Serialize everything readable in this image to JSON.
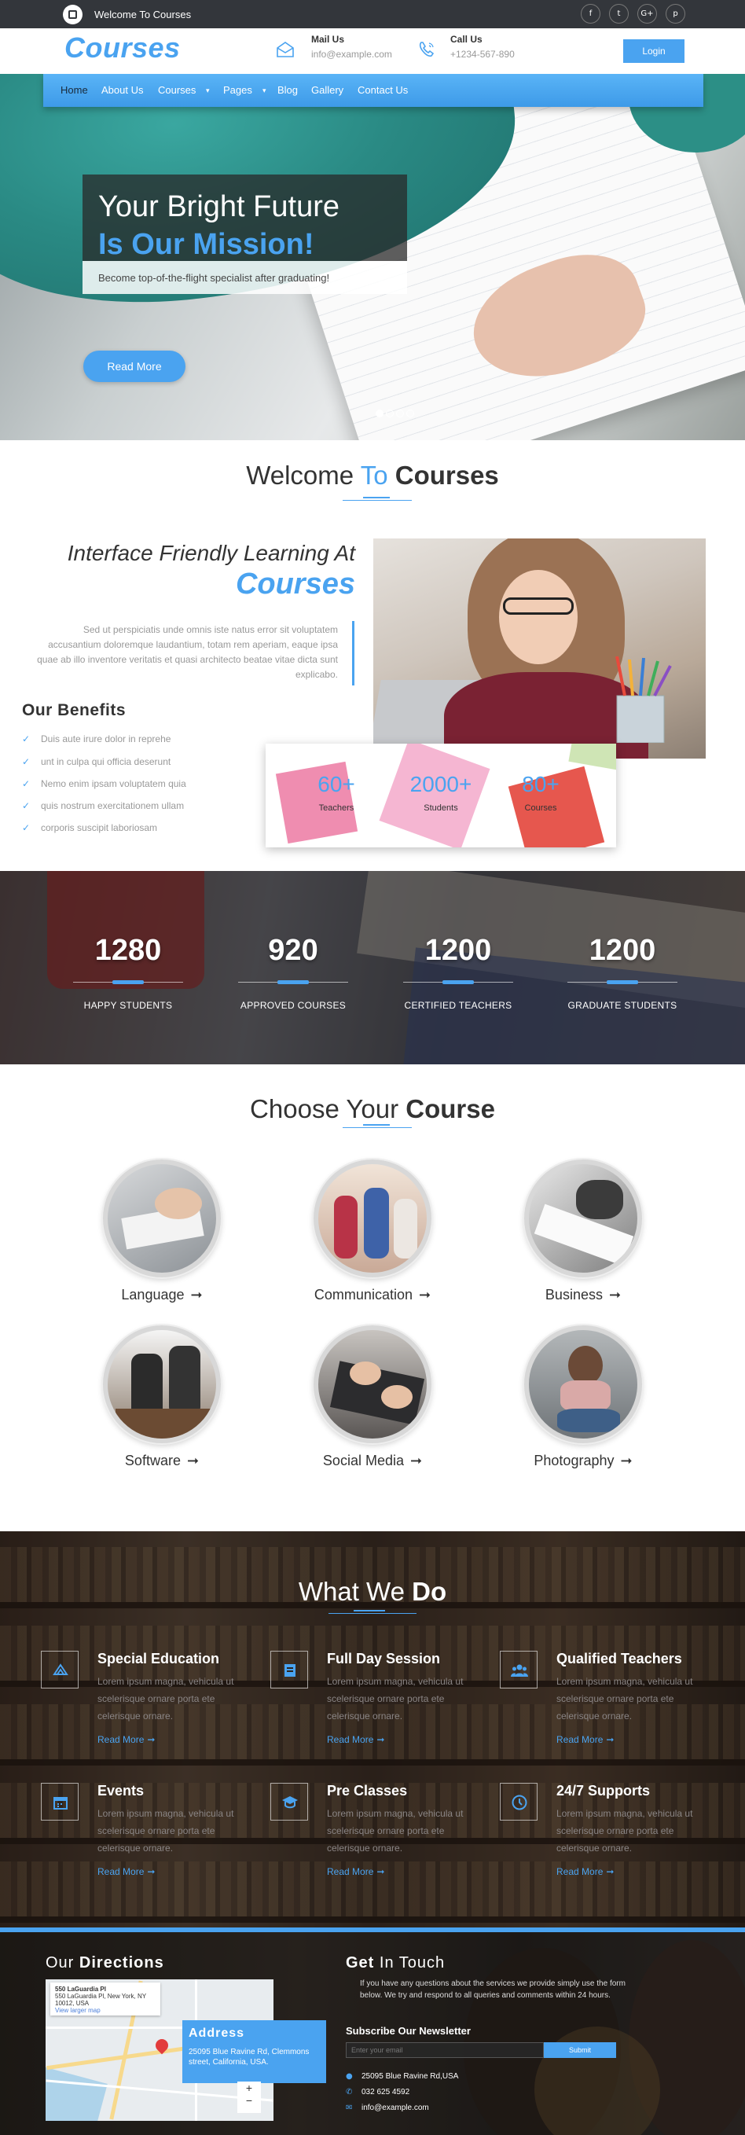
{
  "topbar": {
    "welcome": "Welcome To Courses",
    "social": [
      "f",
      "t",
      "G+",
      "p"
    ]
  },
  "header": {
    "brand": "Courses",
    "mail_title": "Mail Us",
    "mail_value": "info@example.com",
    "call_title": "Call Us",
    "call_value": "+1234-567-890",
    "login": "Login"
  },
  "nav": {
    "items": [
      "Home",
      "About Us",
      "Courses",
      "Pages",
      "Blog",
      "Gallery",
      "Contact Us"
    ],
    "dropdown_marker": "▾"
  },
  "hero": {
    "line1": "Your Bright Future",
    "line2": "Is Our Mission!",
    "sub": "Become top-of-the-flight specialist after graduating!",
    "button": "Read More"
  },
  "welcome": {
    "title_a": "Welcome",
    "title_b": "To",
    "title_c": "Courses",
    "int1": "Interface Friendly Learning At",
    "int2": "Courses",
    "para": "Sed ut perspiciatis unde omnis iste natus error sit voluptatem accusantium doloremque laudantium, totam rem aperiam, eaque ipsa quae ab illo inventore veritatis et quasi architecto beatae vitae dicta sunt explicabo.",
    "benefits_title": "Our Benefits",
    "benefits": [
      "Duis aute irure dolor in reprehe",
      "unt in culpa qui officia deserunt",
      "Nemo enim ipsam voluptatem quia",
      "quis nostrum exercitationem ullam",
      "corporis suscipit laboriosam"
    ],
    "stats": [
      {
        "n": "60+",
        "l": "Teachers"
      },
      {
        "n": "2000+",
        "l": "Students"
      },
      {
        "n": "80+",
        "l": "Courses"
      }
    ]
  },
  "counters": [
    {
      "n": "1280",
      "l": "HAPPY STUDENTS"
    },
    {
      "n": "920",
      "l": "APPROVED COURSES"
    },
    {
      "n": "1200",
      "l": "CERTIFIED TEACHERS"
    },
    {
      "n": "1200",
      "l": "GRADUATE STUDENTS"
    }
  ],
  "courses": {
    "title_a": "Choose",
    "title_b": "Your",
    "title_c": "Course",
    "items": [
      "Language",
      "Communication",
      "Business",
      "Software",
      "Social Media",
      "Photography"
    ],
    "arrow": "➞"
  },
  "wwd": {
    "title_a": "What We",
    "title_b": "Do",
    "items": [
      {
        "h": "Special Education",
        "p": "Lorem ipsum magna, vehicula ut scelerisque ornare porta ete celerisque ornare.",
        "rm": "Read More"
      },
      {
        "h": "Full Day Session",
        "p": "Lorem ipsum magna, vehicula ut scelerisque ornare porta ete celerisque ornare.",
        "rm": "Read More"
      },
      {
        "h": "Qualified Teachers",
        "p": "Lorem ipsum magna, vehicula ut scelerisque ornare porta ete celerisque ornare.",
        "rm": "Read More"
      },
      {
        "h": "Events",
        "p": "Lorem ipsum magna, vehicula ut scelerisque ornare porta ete celerisque ornare.",
        "rm": "Read More"
      },
      {
        "h": "Pre Classes",
        "p": "Lorem ipsum magna, vehicula ut scelerisque ornare porta ete celerisque ornare.",
        "rm": "Read More"
      },
      {
        "h": "24/7 Supports",
        "p": "Lorem ipsum magna, vehicula ut scelerisque ornare porta ete celerisque ornare.",
        "rm": "Read More"
      }
    ]
  },
  "footer": {
    "dir_title_a": "Our",
    "dir_title_b": "Directions",
    "map_place": "550 LaGuardia Pl",
    "map_addr": "550 LaGuardia Pl, New York, NY 10012, USA",
    "map_link": "View larger map",
    "address_title": "Address",
    "address_value": "25095 Blue Ravine Rd, Clemmons street, California, USA.",
    "git_title_a": "Get",
    "git_title_b": "In Touch",
    "git_para": "If you have any questions about the services we provide simply use the form below. We try and respond to all queries and comments within 24 hours.",
    "newsletter_title": "Subscribe Our Newsletter",
    "newsletter_placeholder": "Enter your email",
    "newsletter_button": "Submit",
    "contacts": [
      {
        "icon": "map-pin-icon",
        "v": "25095 Blue Ravine Rd,USA"
      },
      {
        "icon": "phone-icon",
        "v": "032 625 4592"
      },
      {
        "icon": "mail-icon",
        "v": "info@example.com"
      }
    ]
  },
  "colors": {
    "accent": "#4aa3f0",
    "topbar": "#33363b"
  }
}
